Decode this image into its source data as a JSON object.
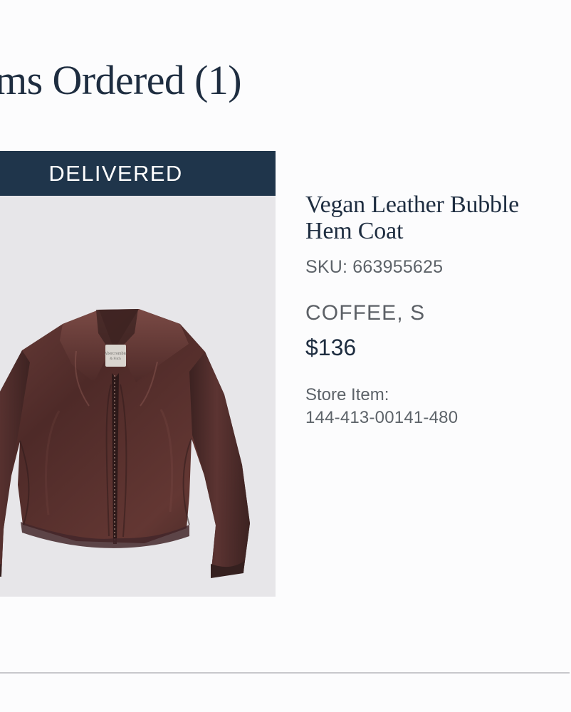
{
  "page": {
    "section_title": "ms Ordered (1)"
  },
  "item": {
    "status": "DELIVERED",
    "name_line_1": "Vegan Leather Bubble",
    "name_line_2": "Hem Coat",
    "sku": "SKU: 663955625",
    "variant": "COFFEE, S",
    "price": "$136",
    "store_item_label": "Store Item:",
    "store_item_number": "144-413-00141-480"
  },
  "colors": {
    "background": "#fcfcfd",
    "heading_navy": "#1e2d40",
    "status_navy": "#1f354b",
    "image_background": "#e7e6e9",
    "muted_text": "#5d6369",
    "jacket_brown": "#4f2b29",
    "divider": "#c8c8cc"
  },
  "icons": {
    "product_photo": "brown-leather-jacket-image"
  }
}
